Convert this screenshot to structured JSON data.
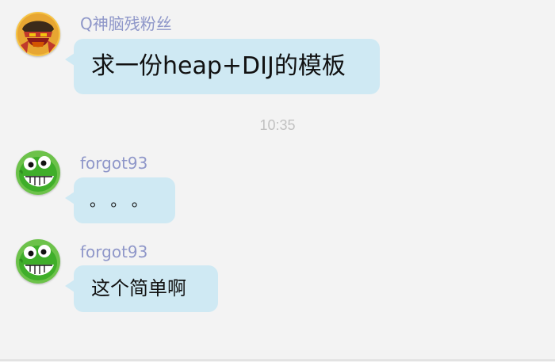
{
  "messages": [
    {
      "sender": "Q神脑残粉丝",
      "text": "求一份heap+DIJ的模板",
      "avatar_icon": "warrior-avatar-icon"
    },
    {
      "sender": "forgot93",
      "text": "。 。 。",
      "avatar_icon": "green-dinosaur-avatar-icon"
    },
    {
      "sender": "forgot93",
      "text": "这个简单啊",
      "avatar_icon": "green-dinosaur-avatar-icon"
    }
  ],
  "timestamp": "10:35",
  "colors": {
    "background": "#f3f3f3",
    "bubble": "#cfe9f3",
    "username": "#8f97c9",
    "timestamp": "#c1c1c1"
  }
}
